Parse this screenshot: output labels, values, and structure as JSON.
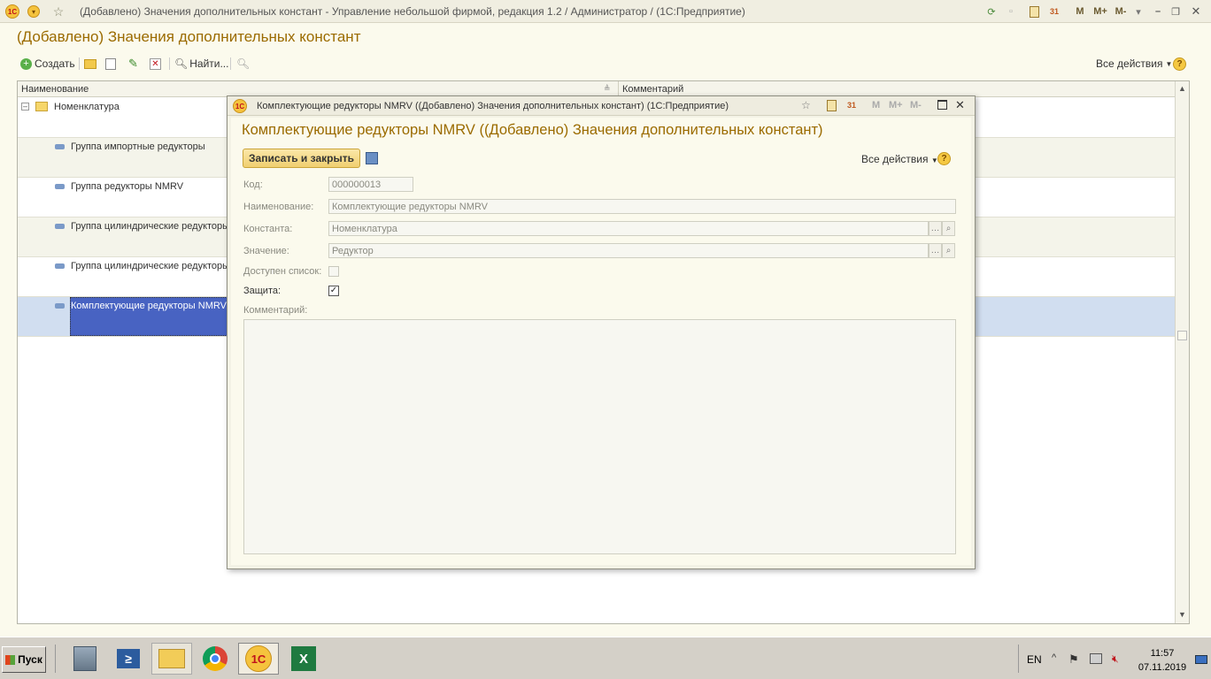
{
  "window": {
    "title": "(Добавлено) Значения дополнительных констант - Управление небольшой фирмой, редакция 1.2 / Администратор /  (1С:Предприятие)",
    "m_label": "M",
    "mplus_label": "M+",
    "mminus_label": "M-",
    "cal_label": "31"
  },
  "page": {
    "title": "(Добавлено) Значения дополнительных констант"
  },
  "toolbar": {
    "create_label": "Создать",
    "find_label": "Найти...",
    "all_actions_label": "Все действия"
  },
  "list": {
    "columns": [
      "Наименование",
      "Комментарий"
    ],
    "root_label": "Номенклатура",
    "rows": [
      {
        "name": "Группа импортные редукторы"
      },
      {
        "name": "Группа редукторы NMRV"
      },
      {
        "name": "Группа цилиндрические редукторы"
      },
      {
        "name": "Группа цилиндрические редукторы"
      },
      {
        "name": "Комплектующие редукторы NMRV"
      }
    ]
  },
  "dialog": {
    "title": "Комплектующие редукторы NMRV ((Добавлено) Значения дополнительных констант)  (1С:Предприятие)",
    "heading": "Комплектующие редукторы NMRV ((Добавлено) Значения дополнительных констант)",
    "save_close_label": "Записать и закрыть",
    "all_actions_label": "Все действия",
    "m_label": "M",
    "mplus_label": "M+",
    "mminus_label": "M-",
    "cal_label": "31",
    "fields": {
      "code_label": "Код:",
      "code_value": "000000013",
      "name_label": "Наименование:",
      "name_value": "Комплектующие редукторы NMRV",
      "constant_label": "Константа:",
      "constant_value": "Номенклатура",
      "value_label": "Значение:",
      "value_value": "Редуктор",
      "list_label": "Доступен список:",
      "list_checked": false,
      "protect_label": "Защита:",
      "protect_checked": true,
      "comment_label": "Комментарий:",
      "comment_value": ""
    }
  },
  "taskbar": {
    "start_label": "Пуск",
    "lang": "EN",
    "time": "11:57",
    "date": "07.11.2019"
  },
  "colors": {
    "accent": "#9b6b00",
    "selection": "#4863c2",
    "selection_row": "#d1def0"
  }
}
